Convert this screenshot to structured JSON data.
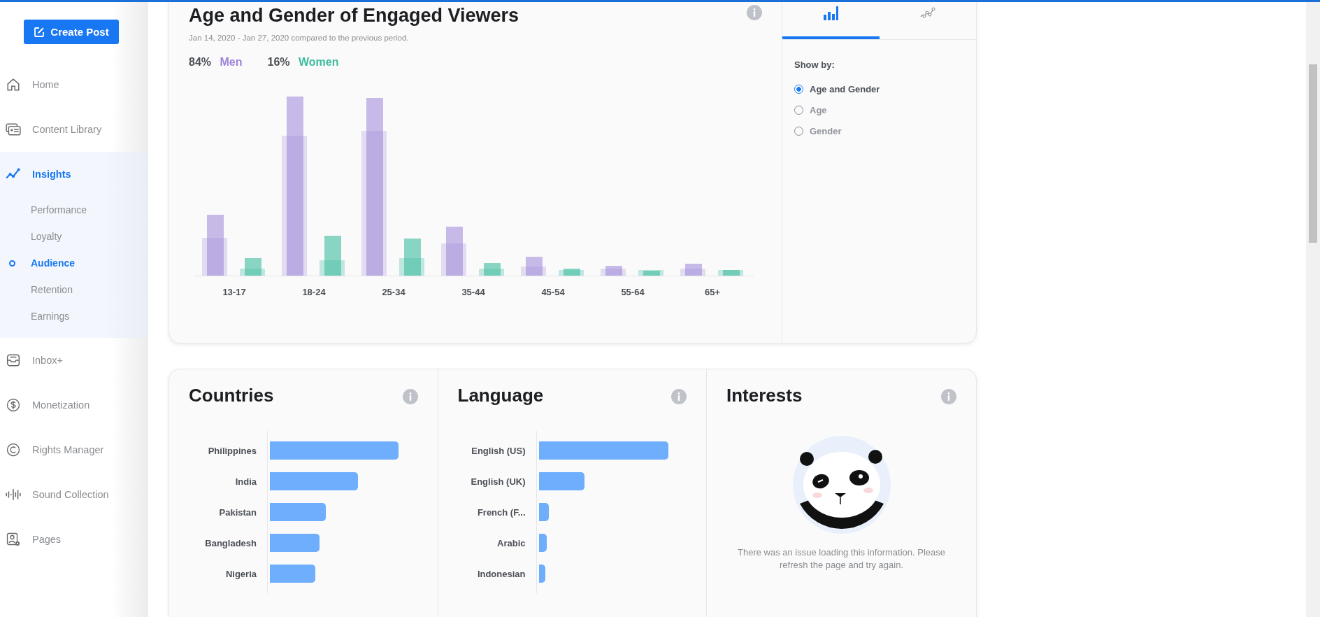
{
  "sidebar": {
    "create_button": "Create Post",
    "items": [
      {
        "label": "Home",
        "selected": false
      },
      {
        "label": "Content Library",
        "selected": false
      },
      {
        "label": "Insights",
        "selected": true,
        "expanded": true,
        "children": [
          {
            "label": "Performance",
            "selected": false
          },
          {
            "label": "Loyalty",
            "selected": false
          },
          {
            "label": "Audience",
            "selected": true
          },
          {
            "label": "Retention",
            "selected": false
          },
          {
            "label": "Earnings",
            "selected": false
          }
        ]
      },
      {
        "label": "Inbox+",
        "selected": false
      },
      {
        "label": "Monetization",
        "selected": false
      },
      {
        "label": "Rights Manager",
        "selected": false
      },
      {
        "label": "Sound Collection",
        "selected": false
      },
      {
        "label": "Pages",
        "selected": false
      }
    ]
  },
  "age_gender": {
    "title": "Age and Gender of Engaged Viewers",
    "subtitle": "Jan 14, 2020 - Jan 27, 2020 compared to the previous period.",
    "legend": [
      {
        "share": "84%",
        "label": "Men",
        "color": "#9d85d8"
      },
      {
        "share": "16%",
        "label": "Women",
        "color": "#3dbd9e"
      }
    ],
    "age_groups": [
      "13-17",
      "18-24",
      "25-34",
      "35-44",
      "45-54",
      "55-64",
      "65+"
    ],
    "view_tabs": [
      {
        "selected": true
      },
      {
        "selected": false
      }
    ],
    "show_by": {
      "label": "Show by:",
      "options": [
        {
          "label": "Age and Gender",
          "selected": true
        },
        {
          "label": "Age",
          "selected": false
        },
        {
          "label": "Gender",
          "selected": false
        }
      ]
    }
  },
  "countries": {
    "title": "Countries",
    "rows": [
      "Philippines",
      "India",
      "Pakistan",
      "Bangladesh",
      "Nigeria"
    ]
  },
  "language": {
    "title": "Language",
    "rows": [
      "English (US)",
      "English (UK)",
      "French (F...",
      "Arabic",
      "Indonesian"
    ]
  },
  "interests": {
    "title": "Interests",
    "message": "There was an issue loading this information. Please refresh the page and try again."
  }
}
